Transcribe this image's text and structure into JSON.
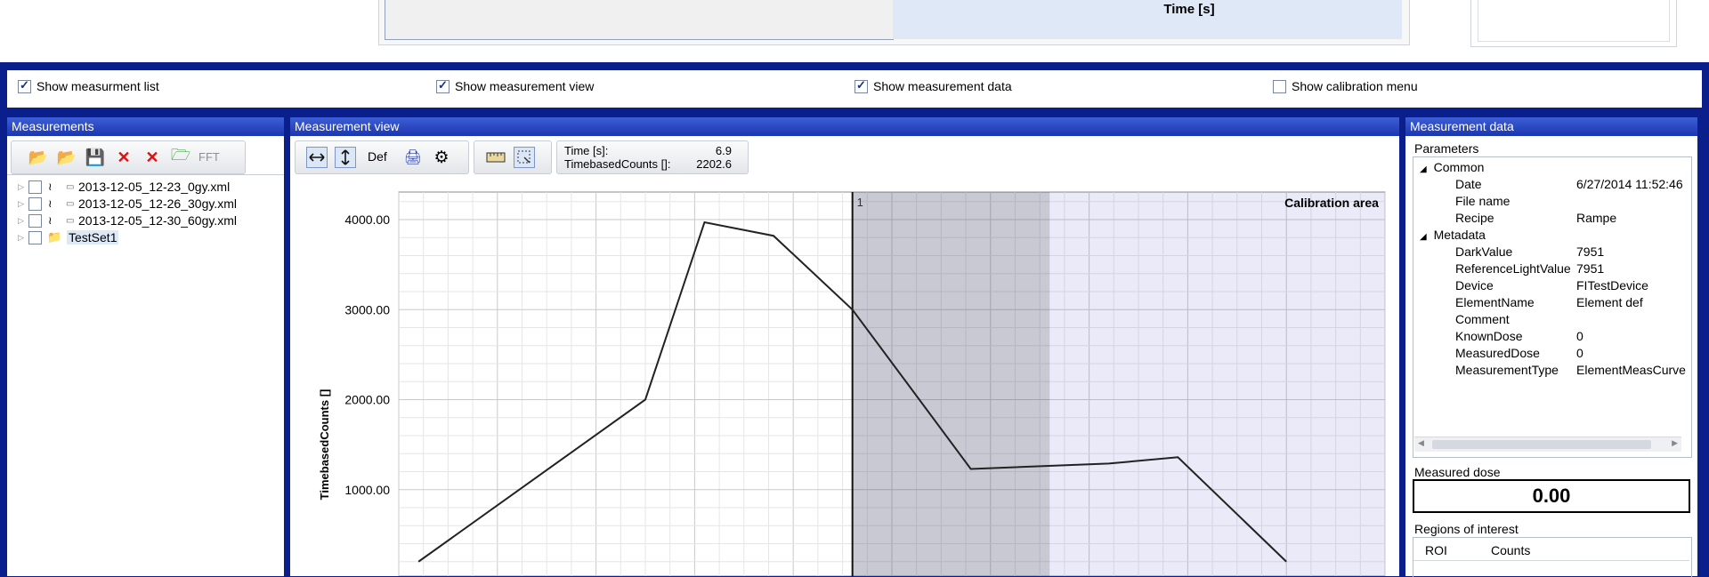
{
  "top": {
    "time_label": "Time [s]"
  },
  "checkbar": {
    "items": [
      {
        "label": "Show measurment list",
        "checked": true
      },
      {
        "label": "Show measurement view",
        "checked": true
      },
      {
        "label": "Show measurement data",
        "checked": true
      },
      {
        "label": "Show calibration menu",
        "checked": false
      }
    ]
  },
  "measurements": {
    "title": "Measurements",
    "fft_label": "FFT",
    "files": [
      "2013-12-05_12-23_0gy.xml",
      "2013-12-05_12-26_30gy.xml",
      "2013-12-05_12-30_60gy.xml"
    ],
    "set": "TestSet1"
  },
  "view": {
    "title": "Measurement view",
    "def_label": "Def",
    "readout": {
      "time_label": "Time [s]:",
      "time_value": "6.9",
      "counts_label": "TimebasedCounts []:",
      "counts_value": "2202.6"
    }
  },
  "chart_data": {
    "type": "line",
    "ylabel": "TimebasedCounts []",
    "yticks": [
      "4000.00",
      "3000.00",
      "2000.00",
      "1000.00"
    ],
    "ylim": [
      200,
      4500
    ],
    "xlim": [
      0,
      10
    ],
    "x": [
      0.2,
      2.5,
      3.1,
      3.8,
      4.6,
      5.8,
      7.2,
      7.9,
      9.0
    ],
    "y": [
      200,
      2000,
      3970,
      3820,
      3000,
      1230,
      1290,
      1360,
      200
    ],
    "marker": {
      "x": 4.6,
      "label": "1"
    },
    "regions": [
      {
        "from": 4.6,
        "to": 6.6
      },
      {
        "from": 6.6,
        "to": 10,
        "label": "Calibration area"
      }
    ]
  },
  "data": {
    "title": "Measurement data",
    "params_label": "Parameters",
    "groups": [
      {
        "name": "Common",
        "props": [
          [
            "Date",
            "6/27/2014 11:52:46"
          ],
          [
            "File name",
            ""
          ],
          [
            "Recipe",
            "Rampe"
          ]
        ]
      },
      {
        "name": "Metadata",
        "props": [
          [
            "DarkValue",
            "7951"
          ],
          [
            "ReferenceLightValue",
            "7951"
          ],
          [
            "Device",
            "FITestDevice"
          ],
          [
            "ElementName",
            "Element def"
          ],
          [
            "Comment",
            ""
          ],
          [
            "KnownDose",
            "0"
          ],
          [
            "MeasuredDose",
            "0"
          ],
          [
            "MeasurementType",
            "ElementMeasCurve"
          ]
        ]
      }
    ],
    "dose_label": "Measured dose",
    "dose_value": "0.00",
    "roi_label": "Regions of interest",
    "roi_cols": [
      "ROI",
      "Counts"
    ]
  },
  "colors": {
    "header": "#1b36b0",
    "frame": "#0b1f8c"
  }
}
